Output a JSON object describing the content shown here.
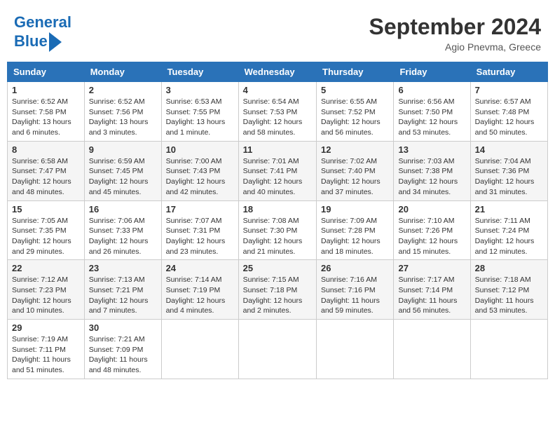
{
  "header": {
    "logo_line1": "General",
    "logo_line2": "Blue",
    "month": "September 2024",
    "location": "Agio Pnevma, Greece"
  },
  "days_of_week": [
    "Sunday",
    "Monday",
    "Tuesday",
    "Wednesday",
    "Thursday",
    "Friday",
    "Saturday"
  ],
  "weeks": [
    [
      {
        "day": "1",
        "info": "Sunrise: 6:52 AM\nSunset: 7:58 PM\nDaylight: 13 hours\nand 6 minutes."
      },
      {
        "day": "2",
        "info": "Sunrise: 6:52 AM\nSunset: 7:56 PM\nDaylight: 13 hours\nand 3 minutes."
      },
      {
        "day": "3",
        "info": "Sunrise: 6:53 AM\nSunset: 7:55 PM\nDaylight: 13 hours\nand 1 minute."
      },
      {
        "day": "4",
        "info": "Sunrise: 6:54 AM\nSunset: 7:53 PM\nDaylight: 12 hours\nand 58 minutes."
      },
      {
        "day": "5",
        "info": "Sunrise: 6:55 AM\nSunset: 7:52 PM\nDaylight: 12 hours\nand 56 minutes."
      },
      {
        "day": "6",
        "info": "Sunrise: 6:56 AM\nSunset: 7:50 PM\nDaylight: 12 hours\nand 53 minutes."
      },
      {
        "day": "7",
        "info": "Sunrise: 6:57 AM\nSunset: 7:48 PM\nDaylight: 12 hours\nand 50 minutes."
      }
    ],
    [
      {
        "day": "8",
        "info": "Sunrise: 6:58 AM\nSunset: 7:47 PM\nDaylight: 12 hours\nand 48 minutes."
      },
      {
        "day": "9",
        "info": "Sunrise: 6:59 AM\nSunset: 7:45 PM\nDaylight: 12 hours\nand 45 minutes."
      },
      {
        "day": "10",
        "info": "Sunrise: 7:00 AM\nSunset: 7:43 PM\nDaylight: 12 hours\nand 42 minutes."
      },
      {
        "day": "11",
        "info": "Sunrise: 7:01 AM\nSunset: 7:41 PM\nDaylight: 12 hours\nand 40 minutes."
      },
      {
        "day": "12",
        "info": "Sunrise: 7:02 AM\nSunset: 7:40 PM\nDaylight: 12 hours\nand 37 minutes."
      },
      {
        "day": "13",
        "info": "Sunrise: 7:03 AM\nSunset: 7:38 PM\nDaylight: 12 hours\nand 34 minutes."
      },
      {
        "day": "14",
        "info": "Sunrise: 7:04 AM\nSunset: 7:36 PM\nDaylight: 12 hours\nand 31 minutes."
      }
    ],
    [
      {
        "day": "15",
        "info": "Sunrise: 7:05 AM\nSunset: 7:35 PM\nDaylight: 12 hours\nand 29 minutes."
      },
      {
        "day": "16",
        "info": "Sunrise: 7:06 AM\nSunset: 7:33 PM\nDaylight: 12 hours\nand 26 minutes."
      },
      {
        "day": "17",
        "info": "Sunrise: 7:07 AM\nSunset: 7:31 PM\nDaylight: 12 hours\nand 23 minutes."
      },
      {
        "day": "18",
        "info": "Sunrise: 7:08 AM\nSunset: 7:30 PM\nDaylight: 12 hours\nand 21 minutes."
      },
      {
        "day": "19",
        "info": "Sunrise: 7:09 AM\nSunset: 7:28 PM\nDaylight: 12 hours\nand 18 minutes."
      },
      {
        "day": "20",
        "info": "Sunrise: 7:10 AM\nSunset: 7:26 PM\nDaylight: 12 hours\nand 15 minutes."
      },
      {
        "day": "21",
        "info": "Sunrise: 7:11 AM\nSunset: 7:24 PM\nDaylight: 12 hours\nand 12 minutes."
      }
    ],
    [
      {
        "day": "22",
        "info": "Sunrise: 7:12 AM\nSunset: 7:23 PM\nDaylight: 12 hours\nand 10 minutes."
      },
      {
        "day": "23",
        "info": "Sunrise: 7:13 AM\nSunset: 7:21 PM\nDaylight: 12 hours\nand 7 minutes."
      },
      {
        "day": "24",
        "info": "Sunrise: 7:14 AM\nSunset: 7:19 PM\nDaylight: 12 hours\nand 4 minutes."
      },
      {
        "day": "25",
        "info": "Sunrise: 7:15 AM\nSunset: 7:18 PM\nDaylight: 12 hours\nand 2 minutes."
      },
      {
        "day": "26",
        "info": "Sunrise: 7:16 AM\nSunset: 7:16 PM\nDaylight: 11 hours\nand 59 minutes."
      },
      {
        "day": "27",
        "info": "Sunrise: 7:17 AM\nSunset: 7:14 PM\nDaylight: 11 hours\nand 56 minutes."
      },
      {
        "day": "28",
        "info": "Sunrise: 7:18 AM\nSunset: 7:12 PM\nDaylight: 11 hours\nand 53 minutes."
      }
    ],
    [
      {
        "day": "29",
        "info": "Sunrise: 7:19 AM\nSunset: 7:11 PM\nDaylight: 11 hours\nand 51 minutes."
      },
      {
        "day": "30",
        "info": "Sunrise: 7:21 AM\nSunset: 7:09 PM\nDaylight: 11 hours\nand 48 minutes."
      },
      {
        "day": "",
        "info": ""
      },
      {
        "day": "",
        "info": ""
      },
      {
        "day": "",
        "info": ""
      },
      {
        "day": "",
        "info": ""
      },
      {
        "day": "",
        "info": ""
      }
    ]
  ]
}
